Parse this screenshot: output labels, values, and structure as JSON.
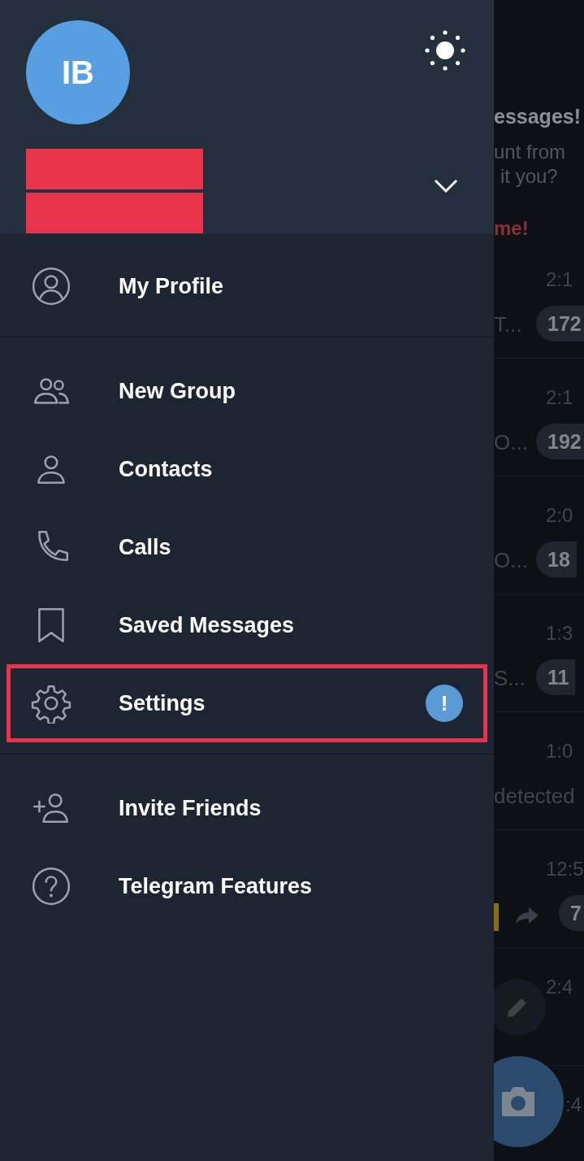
{
  "drawer": {
    "avatar_initials": "IB",
    "name_redacted": true,
    "sections": [
      [
        {
          "kind": "profile",
          "label": "My Profile",
          "highlighted": false,
          "alert": false
        }
      ],
      [
        {
          "kind": "group",
          "label": "New Group",
          "highlighted": false,
          "alert": false
        },
        {
          "kind": "contact",
          "label": "Contacts",
          "highlighted": false,
          "alert": false
        },
        {
          "kind": "phone",
          "label": "Calls",
          "highlighted": false,
          "alert": false
        },
        {
          "kind": "bookmark",
          "label": "Saved Messages",
          "highlighted": false,
          "alert": false
        },
        {
          "kind": "gear",
          "label": "Settings",
          "highlighted": true,
          "alert": true,
          "alert_text": "!"
        }
      ],
      [
        {
          "kind": "invite",
          "label": "Invite Friends",
          "highlighted": false,
          "alert": false
        },
        {
          "kind": "help",
          "label": "Telegram Features",
          "highlighted": false,
          "alert": false
        }
      ]
    ]
  },
  "background": {
    "banner": [
      "essages!",
      "unt from",
      "it you?",
      "me!"
    ],
    "rows": [
      {
        "time": "2:1",
        "preview": "T...",
        "badge": "172",
        "forward": false
      },
      {
        "time": "2:1",
        "preview": "O...",
        "badge": "192",
        "forward": false
      },
      {
        "time": "2:0",
        "preview": "O...",
        "badge": "18",
        "forward": false
      },
      {
        "time": "1:3",
        "preview": "S...",
        "badge": "11",
        "forward": false
      },
      {
        "time": "1:0",
        "preview": "detected",
        "forward": false
      },
      {
        "time": "12:5",
        "badge": "7",
        "forward": true
      },
      {
        "time": "2:4",
        "forward": false
      },
      {
        "time": ":4",
        "forward": false
      }
    ]
  }
}
